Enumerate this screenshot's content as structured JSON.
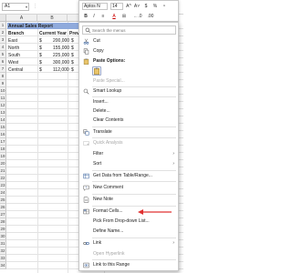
{
  "formula_bar": {
    "name_box": "A1",
    "more": "⋮"
  },
  "columns": [
    "",
    "A",
    "B",
    "C"
  ],
  "rows": [
    "1",
    "2",
    "3",
    "4",
    "5",
    "6",
    "7",
    "8",
    "9",
    "10",
    "11",
    "12",
    "13",
    "14",
    "15",
    "16",
    "17",
    "18",
    "19",
    "20",
    "21",
    "22",
    "23",
    "24",
    "25",
    "26",
    "27",
    "28",
    "29",
    "30",
    "31",
    "32",
    "33",
    "34"
  ],
  "sheet": {
    "title": "Annual Sales Report",
    "headers": [
      "Branch",
      "Current Year",
      "Prev"
    ],
    "data": [
      {
        "branch": "East",
        "cur": "$",
        "cur_val": "200,000",
        "prev": "$"
      },
      {
        "branch": "North",
        "cur": "$",
        "cur_val": "155,000",
        "prev": "$"
      },
      {
        "branch": "South",
        "cur": "$",
        "cur_val": "225,000",
        "prev": "$"
      },
      {
        "branch": "West",
        "cur": "$",
        "cur_val": "300,000",
        "prev": "$"
      },
      {
        "branch": "Central",
        "cur": "$",
        "cur_val": "112,000",
        "prev": "$"
      }
    ]
  },
  "mini_toolbar": {
    "font": "Aptos N",
    "size": "14",
    "buttons": [
      "A^",
      "A˅",
      "$",
      "%",
      "⁹",
      "B",
      "I",
      "≡",
      "A",
      "⊞",
      "←.0",
      ".00"
    ]
  },
  "context_menu": {
    "search_placeholder": "Search the menus",
    "items": [
      {
        "label": "Cut",
        "icon": "scissors-icon",
        "disabled": false
      },
      {
        "label": "Copy",
        "icon": "copy-icon",
        "disabled": false
      },
      {
        "label": "Paste Options:",
        "icon": "clipboard-icon",
        "disabled": false
      },
      {
        "label": "Paste Special...",
        "icon": "",
        "disabled": true
      },
      {
        "label": "Smart Lookup",
        "icon": "smart-lookup-icon",
        "disabled": false
      },
      {
        "label": "Insert...",
        "icon": "",
        "disabled": false
      },
      {
        "label": "Delete...",
        "icon": "",
        "disabled": false
      },
      {
        "label": "Clear Contents",
        "icon": "",
        "disabled": false
      },
      {
        "label": "Translate",
        "icon": "translate-icon",
        "disabled": false
      },
      {
        "label": "Quick Analysis",
        "icon": "quick-analysis-icon",
        "disabled": true
      },
      {
        "label": "Filter",
        "icon": "",
        "disabled": false,
        "submenu": true
      },
      {
        "label": "Sort",
        "icon": "",
        "disabled": false,
        "submenu": true
      },
      {
        "label": "Get Data from Table/Range...",
        "icon": "table-icon",
        "disabled": false
      },
      {
        "label": "New Comment",
        "icon": "comment-icon",
        "disabled": false
      },
      {
        "label": "New Note",
        "icon": "note-icon",
        "disabled": false
      },
      {
        "label": "Format Cells...",
        "icon": "format-cells-icon",
        "disabled": false
      },
      {
        "label": "Pick From Drop-down List...",
        "icon": "",
        "disabled": false
      },
      {
        "label": "Define Name...",
        "icon": "",
        "disabled": false
      },
      {
        "label": "Link",
        "icon": "link-icon",
        "disabled": false,
        "submenu": true
      },
      {
        "label": "Open Hyperlink",
        "icon": "",
        "disabled": true
      },
      {
        "label": "Link to this Range",
        "icon": "link-range-icon",
        "disabled": false
      }
    ]
  },
  "colors": {
    "title_fill": "#8faadc",
    "annotation_arrow": "#e03030",
    "icon_blue": "#2b5797"
  }
}
